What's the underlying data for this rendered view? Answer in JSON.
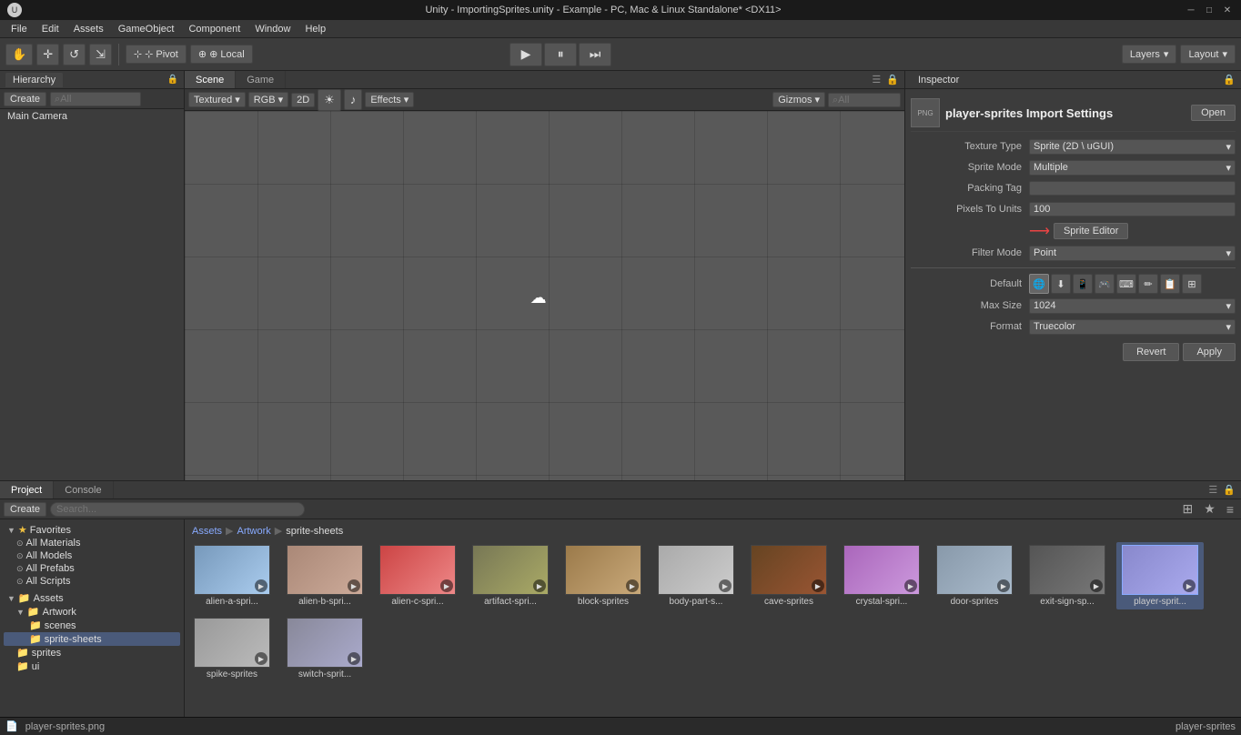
{
  "window": {
    "title": "Unity - ImportingSprites.unity - Example - PC, Mac & Linux Standalone* <DX11>",
    "logo": "U",
    "min": "─",
    "max": "□",
    "close": "✕"
  },
  "menubar": {
    "items": [
      "File",
      "Edit",
      "Assets",
      "GameObject",
      "Component",
      "Window",
      "Help"
    ]
  },
  "toolbar": {
    "hand_tool": "✋",
    "move_tool": "✛",
    "rotate_tool": "↺",
    "scale_tool": "⇲",
    "pivot_label": "⊹ Pivot",
    "local_label": "⊕ Local",
    "play": "▶",
    "pause": "⏸",
    "step": "⏭",
    "layers_label": "Layers",
    "layout_label": "Layout"
  },
  "hierarchy": {
    "panel_title": "Hierarchy",
    "lock_icon": "🔒",
    "create_label": "Create",
    "search_placeholder": "⌕All",
    "items": [
      "Main Camera"
    ]
  },
  "scene": {
    "tabs": [
      "Scene",
      "Game"
    ],
    "active_tab": "Scene",
    "view_dropdown": "Textured",
    "color_dropdown": "RGB",
    "mode_btn": "2D",
    "lights_icon": "☀",
    "audio_icon": "♪",
    "effects_label": "Effects",
    "gizmos_label": "Gizmos",
    "search_placeholder": "⌕All",
    "lock_icon": "🔒"
  },
  "inspector": {
    "tab_label": "Inspector",
    "asset_name": "player-sprites Import Settings",
    "open_btn": "Open",
    "fields": {
      "texture_type_label": "Texture Type",
      "texture_type_value": "Sprite (2D \\ uGUI)",
      "sprite_mode_label": "Sprite Mode",
      "sprite_mode_value": "Multiple",
      "packing_tag_label": "Packing Tag",
      "packing_tag_value": "",
      "pixels_to_units_label": "Pixels To Units",
      "pixels_to_units_value": "100",
      "sprite_editor_btn": "Sprite Editor",
      "filter_mode_label": "Filter Mode",
      "filter_mode_value": "Point",
      "default_label": "Default",
      "max_size_label": "Max Size",
      "max_size_value": "1024",
      "format_label": "Format",
      "format_value": "Truecolor"
    },
    "revert_btn": "Revert",
    "apply_btn": "Apply",
    "platform_icons": [
      "🌐",
      "⬇",
      "📱",
      "🎮",
      "⌨",
      "✏",
      "📋",
      "⊞"
    ]
  },
  "project": {
    "tabs": [
      "Project",
      "Console"
    ],
    "active_tab": "Project",
    "create_label": "Create",
    "search_placeholder": "",
    "breadcrumb": {
      "assets": "Assets",
      "artwork": "Artwork",
      "sprite_sheets": "sprite-sheets"
    },
    "tree": {
      "favorites_label": "Favorites",
      "favorites_expanded": true,
      "all_materials": "All Materials",
      "all_models": "All Models",
      "all_prefabs": "All Prefabs",
      "all_scripts": "All Scripts",
      "assets_label": "Assets",
      "assets_expanded": true,
      "artwork_label": "Artwork",
      "artwork_expanded": true,
      "scenes_label": "scenes",
      "sprite_sheets_label": "sprite-sheets",
      "sprites_label": "sprites",
      "ui_label": "ui"
    },
    "assets": [
      {
        "name": "alien-a-spri...",
        "thumb_class": "thumb-alien-a"
      },
      {
        "name": "alien-b-spri...",
        "thumb_class": "thumb-alien-b"
      },
      {
        "name": "alien-c-spri...",
        "thumb_class": "thumb-alien-c"
      },
      {
        "name": "artifact-spri...",
        "thumb_class": "thumb-artifact"
      },
      {
        "name": "block-sprites",
        "thumb_class": "thumb-block"
      },
      {
        "name": "body-part-s...",
        "thumb_class": "thumb-body"
      },
      {
        "name": "cave-sprites",
        "thumb_class": "thumb-cave"
      },
      {
        "name": "crystal-spri...",
        "thumb_class": "thumb-crystal"
      },
      {
        "name": "door-sprites",
        "thumb_class": "thumb-door"
      },
      {
        "name": "exit-sign-sp...",
        "thumb_class": "thumb-exit"
      },
      {
        "name": "player-sprit...",
        "thumb_class": "thumb-player",
        "selected": true
      },
      {
        "name": "spike-sprites",
        "thumb_class": "thumb-spike"
      },
      {
        "name": "switch-sprit...",
        "thumb_class": "thumb-switch"
      }
    ]
  },
  "status_bar": {
    "file": "player-sprites.png",
    "asset_name": "player-sprites"
  }
}
